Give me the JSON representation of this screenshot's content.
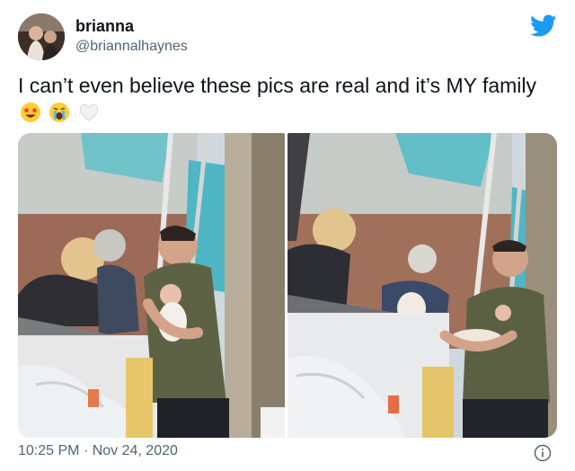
{
  "tweet": {
    "display_name": "brianna",
    "handle": "@briannalhaynes",
    "text": "I can’t even believe these pics are real and it’s MY family",
    "emojis": [
      "star-struck-emoji",
      "crying-face-emoji",
      "white-heart-emoji"
    ],
    "time": "10:25 PM",
    "separator": "·",
    "date": "Nov 24, 2020"
  },
  "icons": {
    "platform": "twitter-bird-icon",
    "info": "info-icon"
  },
  "colors": {
    "brand": "#1d9bf0",
    "secondary_text": "#536471",
    "primary_text": "#0f1419"
  }
}
